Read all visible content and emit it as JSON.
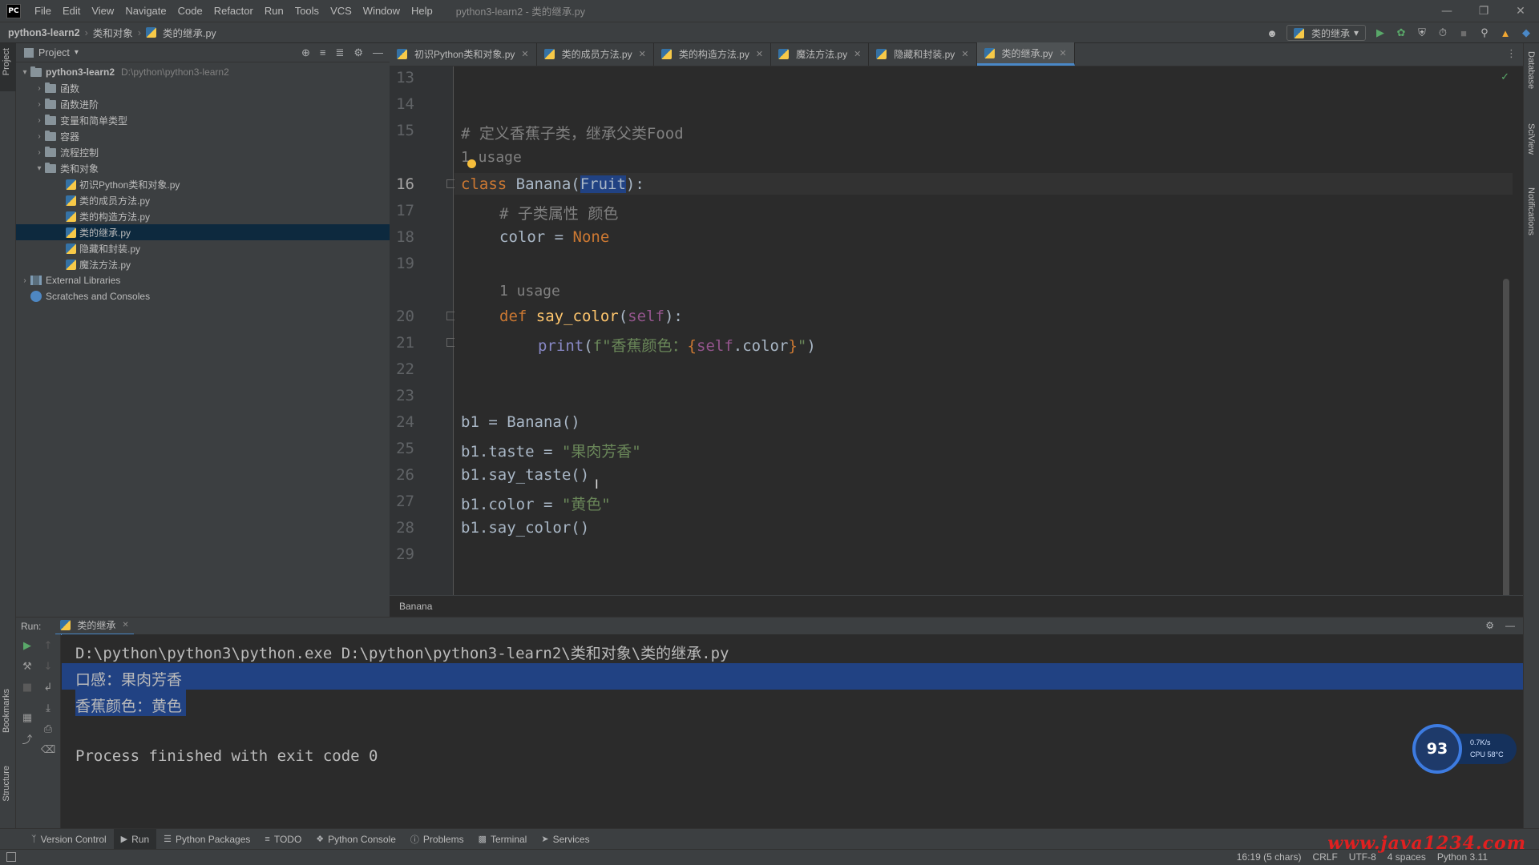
{
  "titlebar": {
    "logo": "PC",
    "menu": [
      "File",
      "Edit",
      "View",
      "Navigate",
      "Code",
      "Refactor",
      "Run",
      "Tools",
      "VCS",
      "Window",
      "Help"
    ],
    "window_title": "python3-learn2 - 类的继承.py"
  },
  "navbar": {
    "project": "python3-learn2",
    "folder": "类和对象",
    "file": "类的继承.py",
    "run_config": "类的继承"
  },
  "left_stripe": {
    "project": "Project",
    "bookmarks": "Bookmarks",
    "structure": "Structure"
  },
  "right_stripe": {
    "database": "Database",
    "sciview": "SciView",
    "notifications": "Notifications"
  },
  "project_panel": {
    "title": "Project",
    "root": {
      "name": "python3-learn2",
      "path": "D:\\python\\python3-learn2"
    },
    "folders": [
      "函数",
      "函数进阶",
      "变量和简单类型",
      "容器",
      "流程控制"
    ],
    "open_folder": "类和对象",
    "files": [
      "初识Python类和对象.py",
      "类的成员方法.py",
      "类的构造方法.py",
      "类的继承.py",
      "隐藏和封装.py",
      "魔法方法.py"
    ],
    "external": "External Libraries",
    "scratches": "Scratches and Consoles"
  },
  "tabs": [
    "初识Python类和对象.py",
    "类的成员方法.py",
    "类的构造方法.py",
    "魔法方法.py",
    "隐藏和封装.py",
    "类的继承.py"
  ],
  "editor": {
    "line_numbers": [
      "13",
      "14",
      "15",
      "16",
      "17",
      "18",
      "19",
      "20",
      "21",
      "22",
      "23",
      "24",
      "25",
      "26",
      "27",
      "28",
      "29"
    ],
    "comment_15": "# 定义香蕉子类，继承父类Food",
    "usage_hint_1": "1 usage",
    "l16_kw": "class",
    "l16_name": " Banana(",
    "l16_parent": "Fruit",
    "l16_end": "):",
    "comment_17": "# 子类属性 颜色",
    "l18_a": "color = ",
    "l18_b": "None",
    "usage_hint_2": "1 usage",
    "l20_kw": "def",
    "l20_fn": " say_color",
    "l20_open": "(",
    "l20_self": "self",
    "l20_close": "):",
    "l21_print": "print",
    "l21_open": "(",
    "l21_str1": "f\"香蕉颜色：",
    "l21_brace1": "{",
    "l21_self": "self",
    "l21_attr": ".color",
    "l21_brace2": "}",
    "l21_str2": "\"",
    "l21_close": ")",
    "l24": "b1 = Banana()",
    "l25_a": "b1.taste = ",
    "l25_b": "\"果肉芳香\"",
    "l26": "b1.say_taste()",
    "l27_a": "b1.color = ",
    "l27_b": "\"黄色\"",
    "l28": "b1.say_color()",
    "breadcrumb": "Banana"
  },
  "run_panel": {
    "label": "Run:",
    "tab": "类的继承",
    "cmd": "D:\\python\\python3\\python.exe D:\\python\\python3-learn2\\类和对象\\类的继承.py",
    "out1": "口感：果肉芳香",
    "out2": "香蕉颜色：黄色",
    "exit": "Process finished with exit code 0"
  },
  "cpu_widget": {
    "value": "93",
    "speed": "0.7K/s",
    "temp": "CPU 58°C"
  },
  "bottom_tools": [
    "Version Control",
    "Run",
    "Python Packages",
    "TODO",
    "Python Console",
    "Problems",
    "Terminal",
    "Services"
  ],
  "status": {
    "position": "16:19 (5 chars)",
    "line_sep": "CRLF",
    "encoding": "UTF-8",
    "indent": "4 spaces",
    "interpreter": "Python 3.11"
  },
  "watermark": "www.java1234.com",
  "colors": {
    "accent": "#4a88c7",
    "selection": "#214283",
    "keyword": "#cc7832",
    "string": "#6a8759"
  }
}
